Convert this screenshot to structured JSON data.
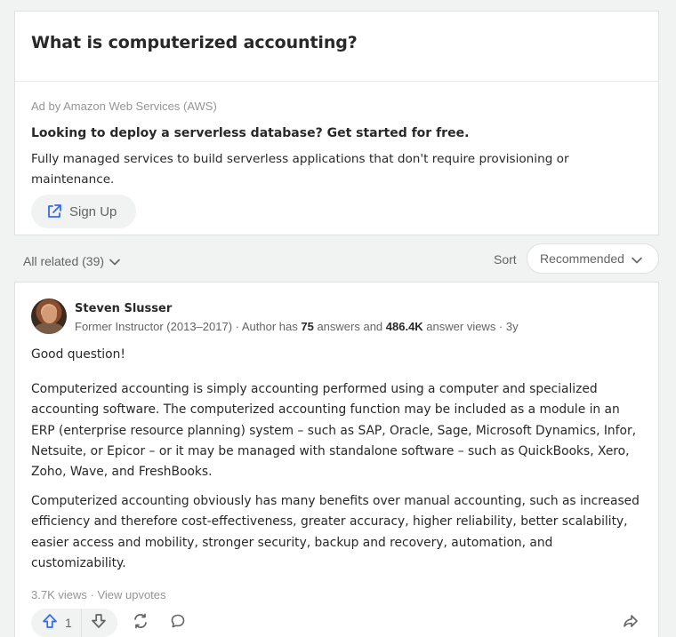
{
  "question": {
    "title": "What is computerized accounting?"
  },
  "ad": {
    "label": "Ad by Amazon Web Services (AWS)",
    "headline": "Looking to deploy a serverless database? Get started for free.",
    "body": "Fully managed services to build serverless applications that don't require provisioning or maintenance.",
    "cta_label": "Sign Up",
    "cta_icon": "external-link-icon"
  },
  "related": {
    "label": "All related (39)",
    "sort_label": "Sort",
    "sort_value": "Recommended"
  },
  "answer": {
    "author_name": "Steven Slusser",
    "credential_prefix": "Former Instructor (2013–2017) · Author has ",
    "answers_count": "75",
    "credential_mid": " answers and ",
    "answer_views": "486.4K",
    "credential_suffix": " answer views · ",
    "age": "3y",
    "paragraphs": [
      "Good question!",
      "Computerized accounting is simply accounting performed using a computer and specialized accounting software. The computerized accounting function may be included as a module in an ERP (enterprise resource planning) system – such as SAP, Oracle, Sage, Microsoft Dynamics, Infor, Netsuite, or Epicor – or it may be managed with standalone software – such as QuickBooks, Xero, Zoho, Wave, and FreshBooks.",
      "Computerized accounting obviously has many benefits over manual accounting, such as increased efficiency and therefore cost-effectiveness, greater accuracy, higher reliability, better scalability, easier access and mobility, stronger security, backup and recovery, automation, and customizability."
    ],
    "views": "3.7K views",
    "separator": " · ",
    "view_upvotes": "View upvotes",
    "upvote_count": "1"
  },
  "colors": {
    "accent": "#2e69ff",
    "text_primary": "#282829",
    "text_secondary": "#636466",
    "text_muted": "#939598",
    "page_bg": "#f1f2f2"
  }
}
